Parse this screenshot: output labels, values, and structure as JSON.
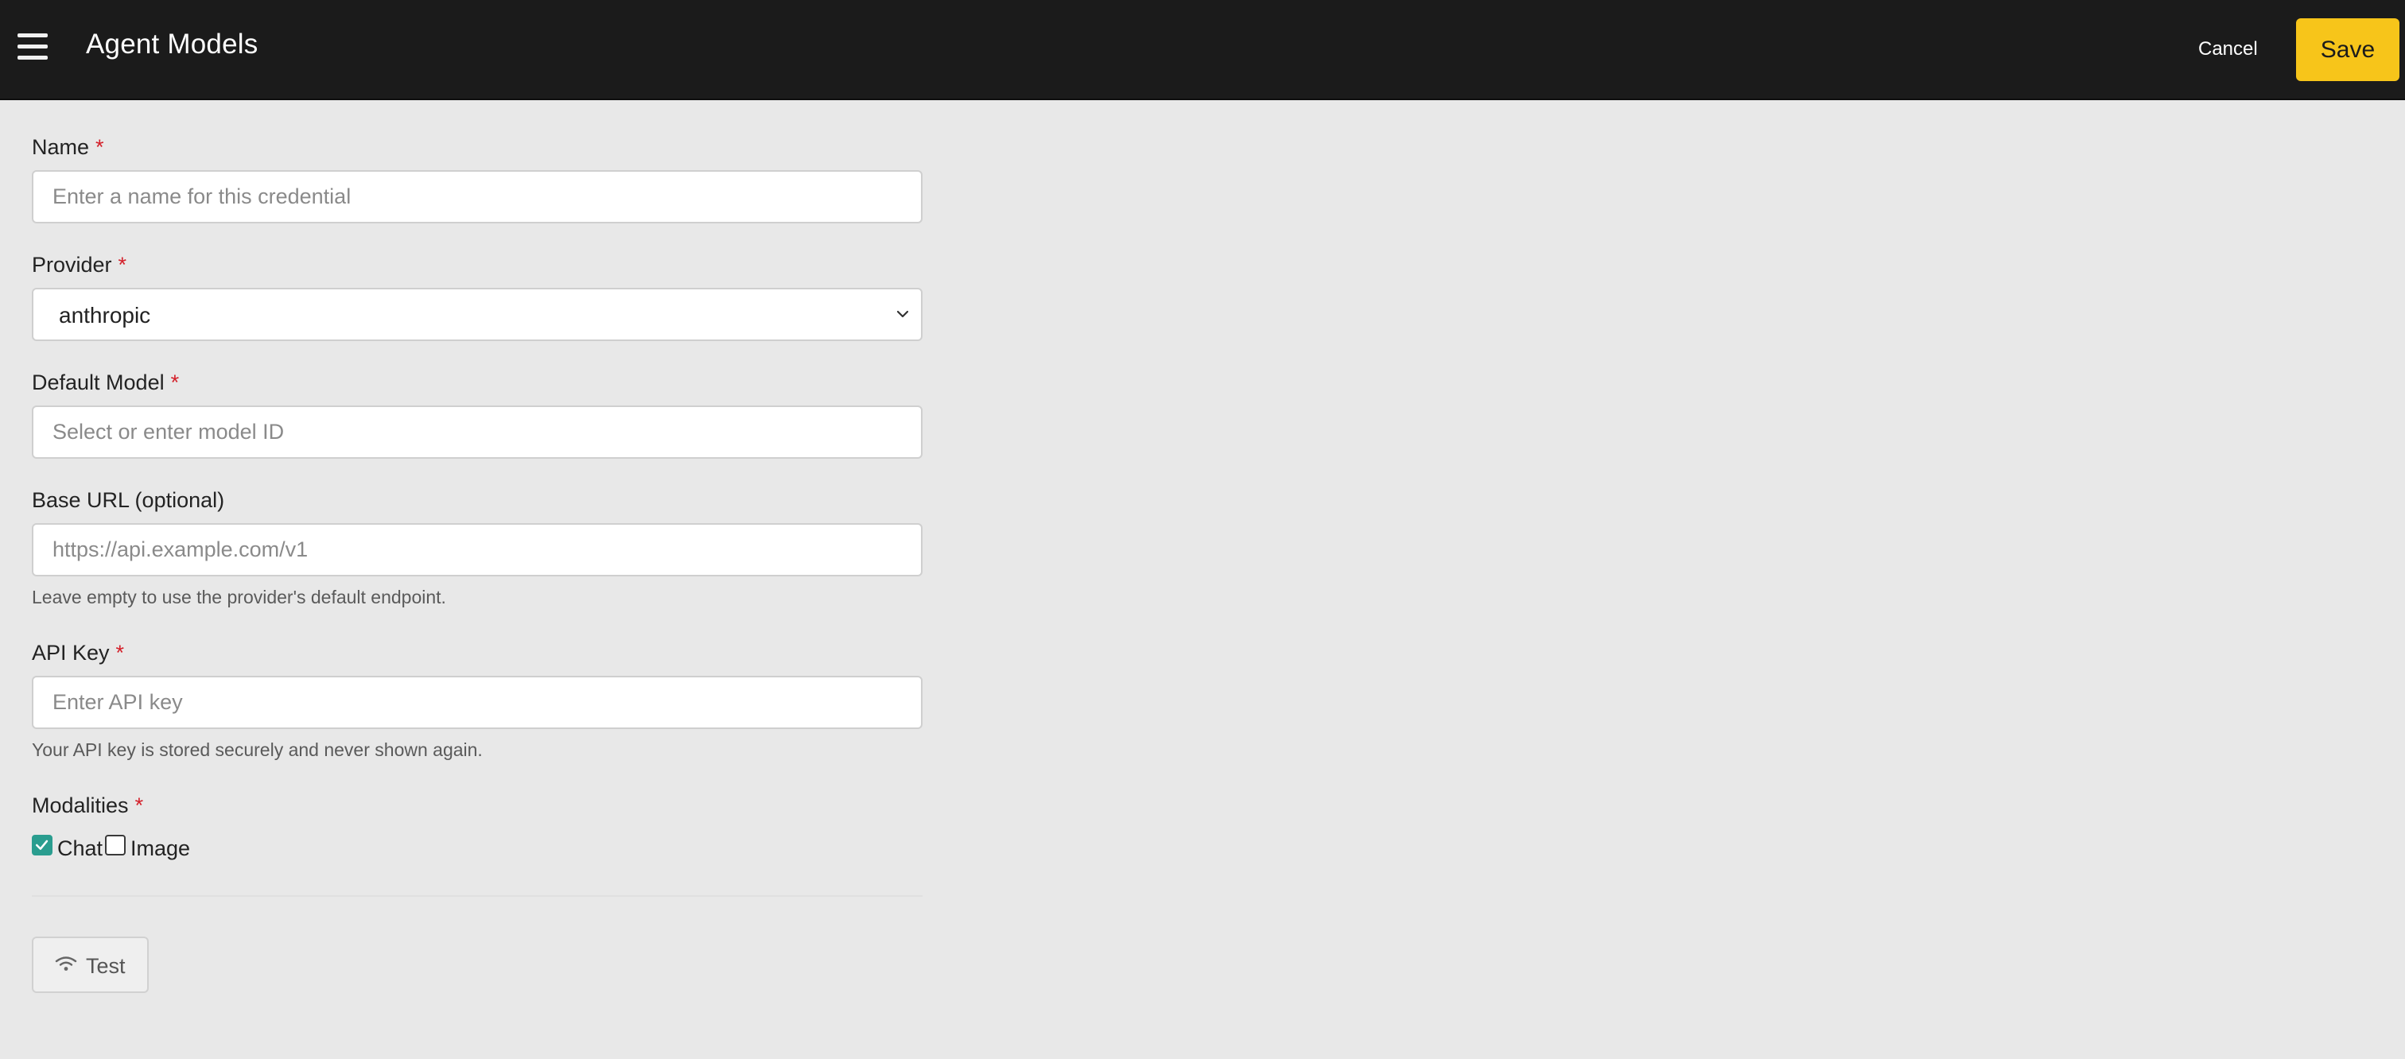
{
  "header": {
    "title": "Agent Models",
    "cancel_label": "Cancel",
    "save_label": "Save"
  },
  "form": {
    "name": {
      "label": "Name",
      "required_mark": "*",
      "value": "",
      "placeholder": "Enter a name for this credential"
    },
    "provider": {
      "label": "Provider",
      "required_mark": "*",
      "selected": "anthropic"
    },
    "default_model": {
      "label": "Default Model",
      "required_mark": "*",
      "value": "",
      "placeholder": "Select or enter model ID"
    },
    "base_url": {
      "label": "Base URL (optional)",
      "value": "",
      "placeholder": "https://api.example.com/v1",
      "hint": "Leave empty to use the provider's default endpoint."
    },
    "api_key": {
      "label": "API Key",
      "required_mark": "*",
      "value": "",
      "placeholder": "Enter API key",
      "hint": "Your API key is stored securely and never shown again."
    },
    "modalities": {
      "label": "Modalities",
      "required_mark": "*",
      "options": [
        {
          "label": "Chat",
          "checked": true
        },
        {
          "label": "Image",
          "checked": false
        }
      ]
    },
    "test_label": "Test"
  },
  "colors": {
    "header_bg": "#1b1b1b",
    "save_accent": "#f7c51a",
    "required": "#d4202a",
    "checkbox_checked": "#2a9d8f",
    "page_bg": "#e8e8e8"
  },
  "icons": [
    "menu-icon",
    "chevron-down-icon",
    "checkmark-icon",
    "wifi-icon"
  ]
}
